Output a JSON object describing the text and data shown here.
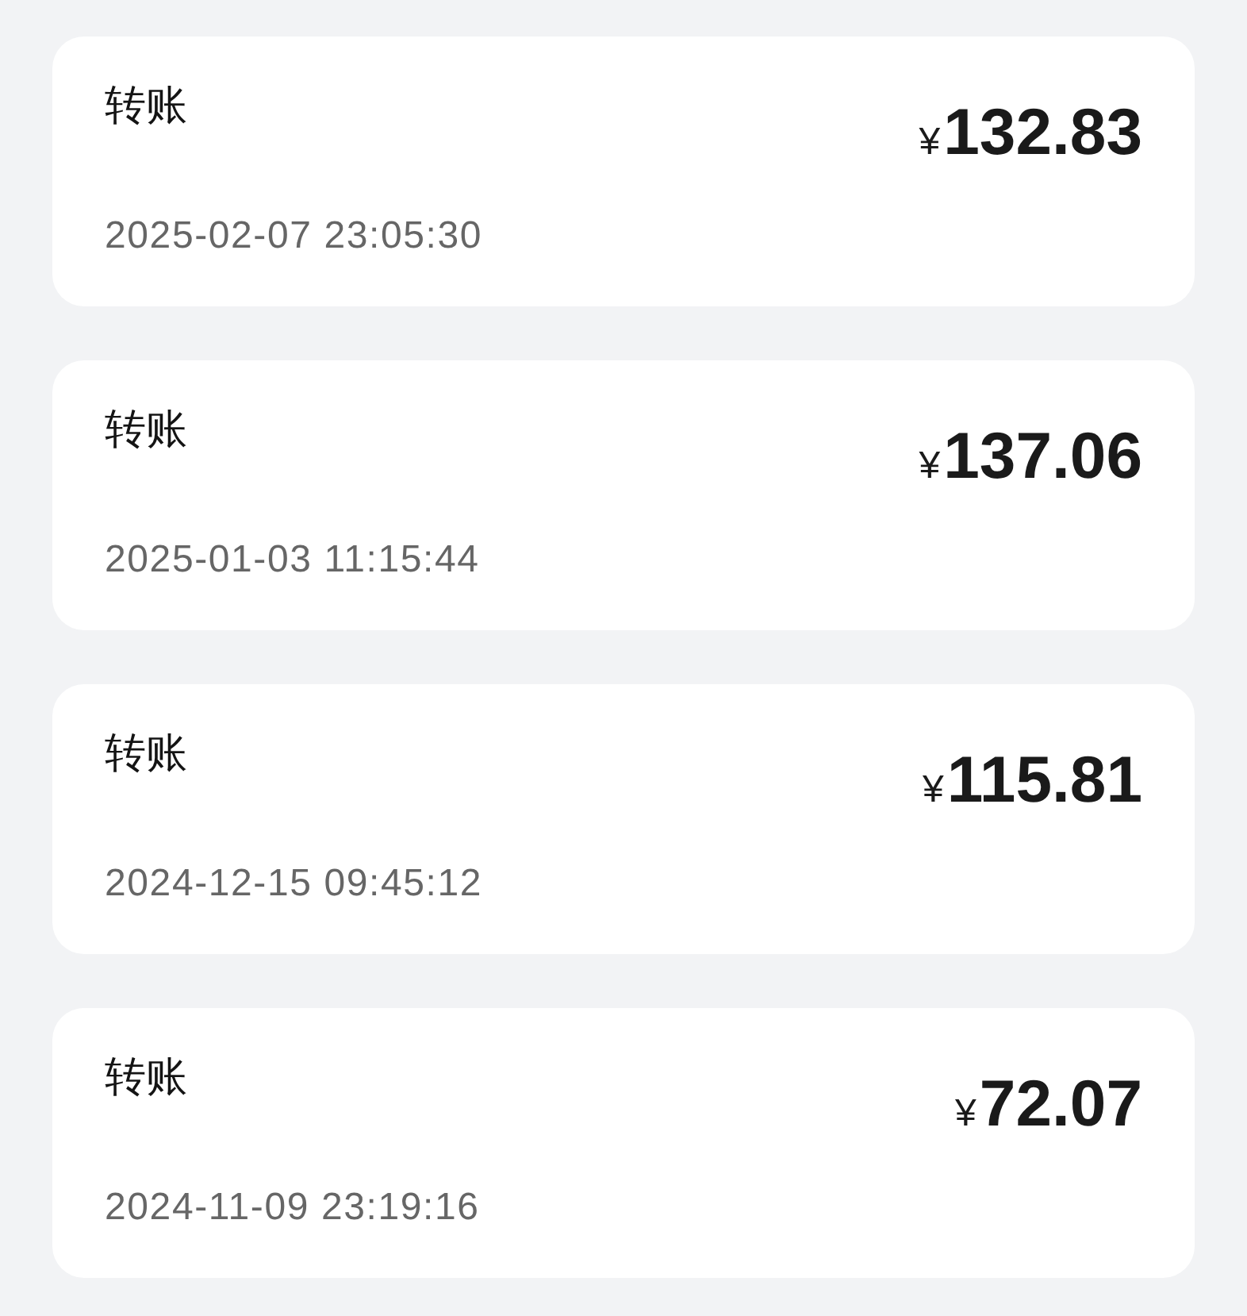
{
  "transactions": [
    {
      "title": "转账",
      "currency": "¥",
      "amount": "132.83",
      "time": "2025-02-07 23:05:30"
    },
    {
      "title": "转账",
      "currency": "¥",
      "amount": "137.06",
      "time": "2025-01-03 11:15:44"
    },
    {
      "title": "转账",
      "currency": "¥",
      "amount": "115.81",
      "time": "2024-12-15 09:45:12"
    },
    {
      "title": "转账",
      "currency": "¥",
      "amount": "72.07",
      "time": "2024-11-09 23:19:16"
    }
  ]
}
